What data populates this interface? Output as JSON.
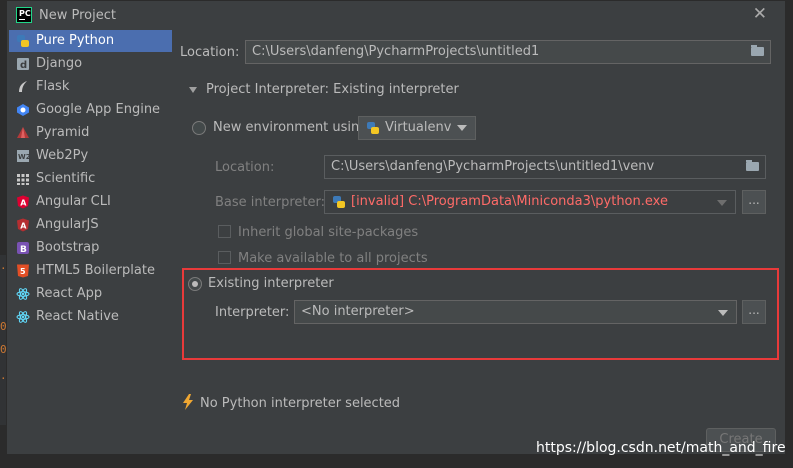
{
  "window": {
    "title": "New Project",
    "close_glyph": "✕",
    "app_icon_text": "PC"
  },
  "sidebar": {
    "items": [
      {
        "label": "Pure Python",
        "icon": "python-icon",
        "selected": true
      },
      {
        "label": "Django",
        "icon": "django-icon"
      },
      {
        "label": "Flask",
        "icon": "flask-icon"
      },
      {
        "label": "Google App Engine",
        "icon": "google-app-engine-icon"
      },
      {
        "label": "Pyramid",
        "icon": "pyramid-icon"
      },
      {
        "label": "Web2Py",
        "icon": "web2py-icon"
      },
      {
        "label": "Scientific",
        "icon": "scientific-icon"
      },
      {
        "label": "Angular CLI",
        "icon": "angular-cli-icon"
      },
      {
        "label": "AngularJS",
        "icon": "angularjs-icon"
      },
      {
        "label": "Bootstrap",
        "icon": "bootstrap-icon"
      },
      {
        "label": "HTML5 Boilerplate",
        "icon": "html5-icon"
      },
      {
        "label": "React App",
        "icon": "react-icon"
      },
      {
        "label": "React Native",
        "icon": "react-native-icon"
      }
    ]
  },
  "main": {
    "location_label": "Location:",
    "location_value": "C:\\Users\\danfeng\\PycharmProjects\\untitled1",
    "interpreter_section": "Project Interpreter: Existing interpreter",
    "new_env_label": "New environment using",
    "new_env_tool": "Virtualenv",
    "venv_location_label": "Location:",
    "venv_location_value": "C:\\Users\\danfeng\\PycharmProjects\\untitled1\\venv",
    "base_interpreter_label": "Base interpreter:",
    "base_interpreter_invalid": "[invalid]",
    "base_interpreter_value": "C:\\ProgramData\\Miniconda3\\python.exe",
    "inherit_label": "Inherit global site-packages",
    "make_available_label": "Make available to all projects",
    "existing_label": "Existing interpreter",
    "interpreter_label": "Interpreter:",
    "interpreter_value": "<No interpreter>",
    "dots": "...",
    "warning": "No Python interpreter selected"
  },
  "footer": {
    "create_label": "Create"
  },
  "watermark": "https://blog.csdn.net/math_and_fire",
  "colors": {
    "selection": "#4b6eaf",
    "highlight_box": "#e83a3a",
    "error": "#ff6b68",
    "warning": "#f0a732"
  }
}
